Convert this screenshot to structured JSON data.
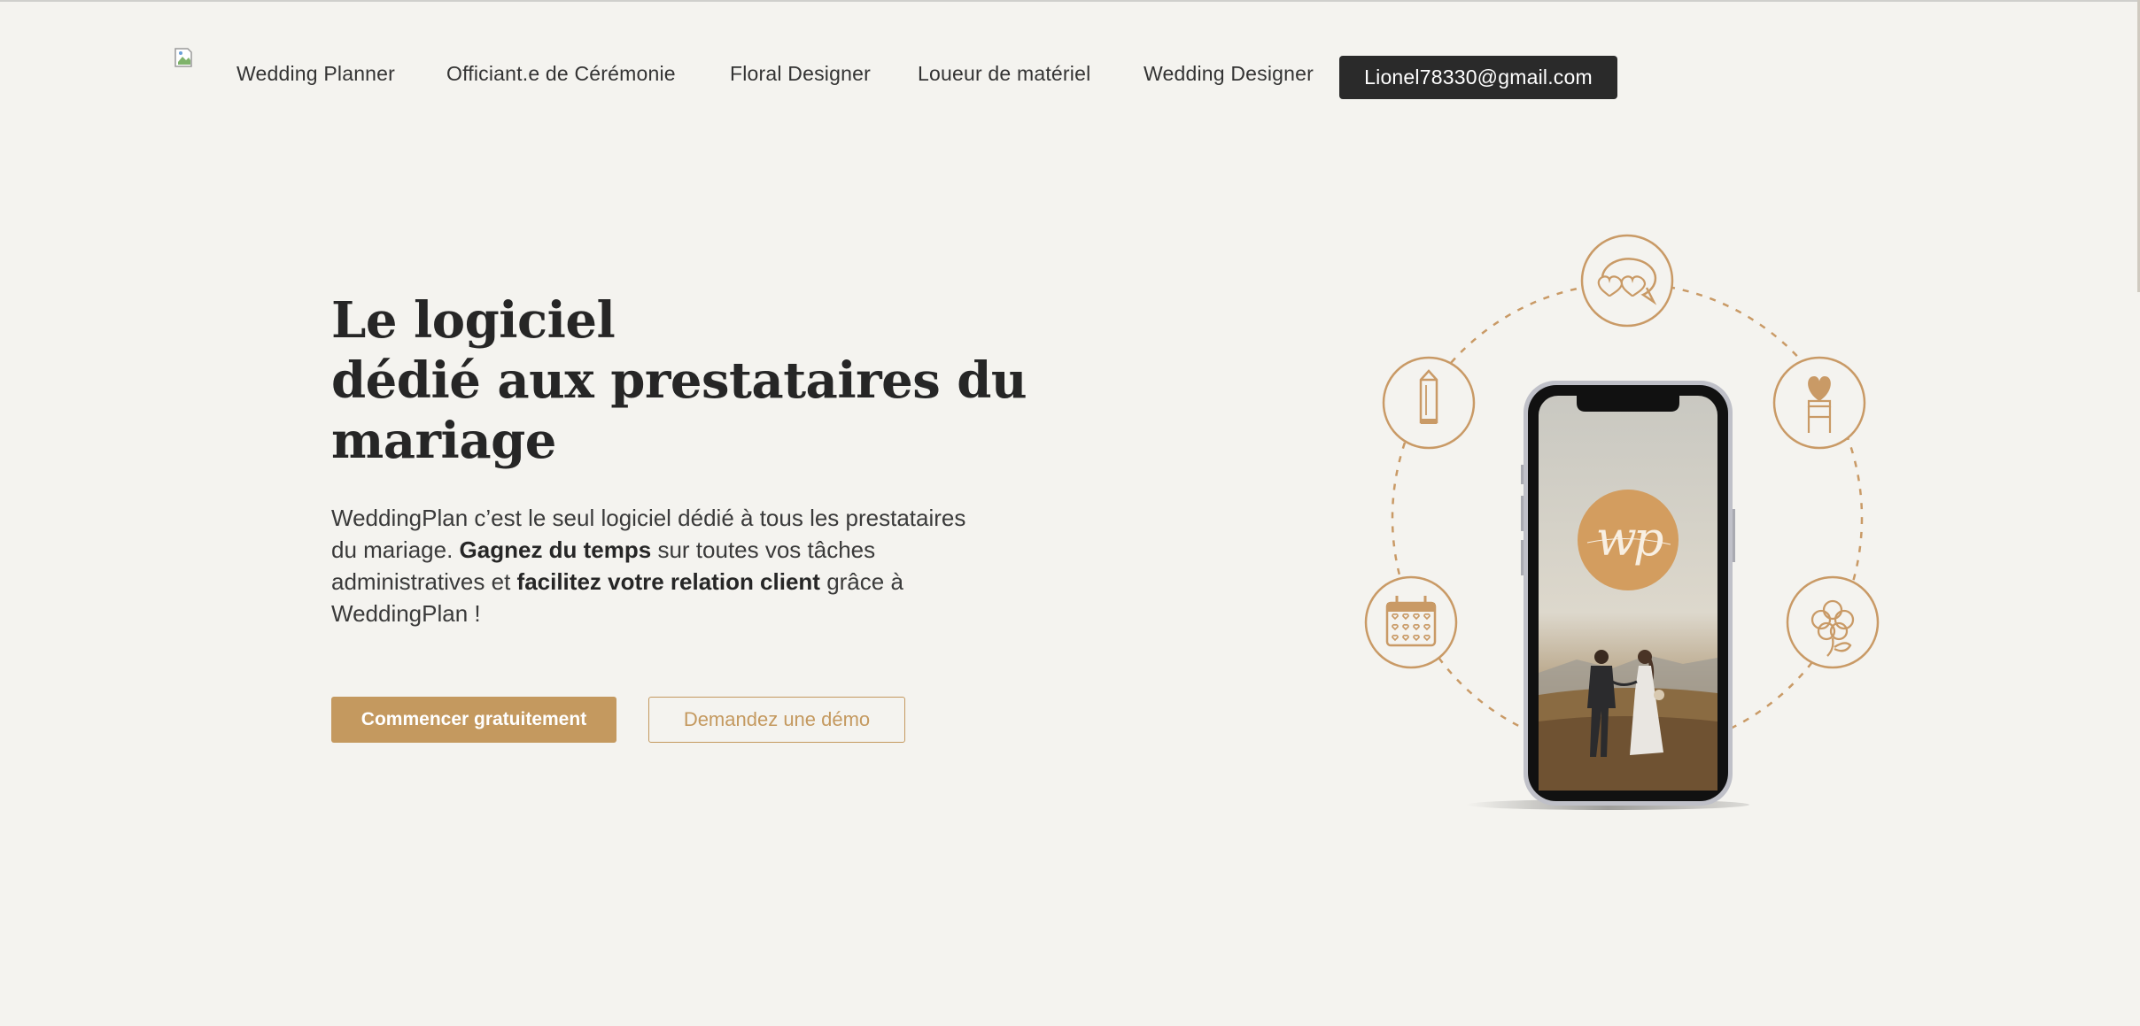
{
  "nav": {
    "items": [
      {
        "label": "Wedding Planner"
      },
      {
        "label": "Officiant.e de Cérémonie"
      },
      {
        "label": "Floral Designer"
      },
      {
        "label": "Loueur de matériel"
      },
      {
        "label": "Wedding Designer"
      }
    ],
    "account_email": "Lionel78330@gmail.com"
  },
  "hero": {
    "title_lines": [
      "Le logiciel",
      "dédié aux prestataires du",
      "mariage"
    ],
    "description": {
      "part1": "WeddingPlan c’est le seul logiciel dédié à tous les prestataires du mariage. ",
      "bold1": "Gagnez du temps",
      "part2": " sur toutes vos tâches administratives et ",
      "bold2": "facilitez votre relation client",
      "part3": " grâce à WeddingPlan !"
    },
    "cta_primary": "Commencer gratuitement",
    "cta_secondary": "Demandez une démo"
  },
  "illustration": {
    "icons": [
      "heart-chat-icon",
      "pencil-icon",
      "heart-chair-icon",
      "calendar-hearts-icon",
      "flower-icon"
    ],
    "phone_monogram_icon": "wp-monogram-icon",
    "phone_photo": "couple-walking-photo"
  },
  "colors": {
    "background": "#f4f3ef",
    "accent": "#c4995f",
    "dark": "#2a2a2a"
  }
}
